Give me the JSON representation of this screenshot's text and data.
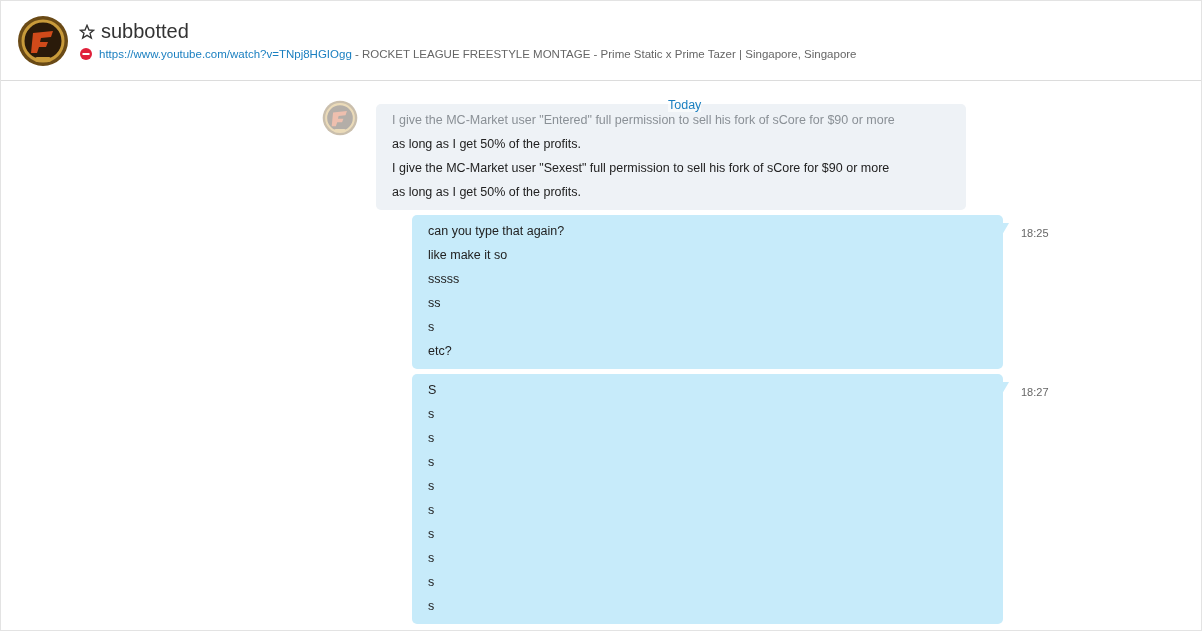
{
  "header": {
    "name": "subbotted",
    "favorite": false,
    "busy": true,
    "mood_link": "https://www.youtube.com/watch?v=TNpj8HGIOgg",
    "mood_text": " - ROCKET LEAGUE FREESTYLE MONTAGE - Prime Static x Prime Tazer",
    "separator": "|",
    "location": "Singapore, Singapore"
  },
  "date_divider": "Today",
  "messages": [
    {
      "kind": "incoming",
      "lines": [
        {
          "text": "I give the MC-Market user \"Entered\" full permission to sell his fork of sCore for $90 or more",
          "faded": true
        },
        {
          "text": "as long as I get 50% of the profits.",
          "faded": false
        },
        {
          "text": "I give the MC-Market user \"Sexest\" full permission to sell his fork of sCore for $90 or more",
          "faded": false
        },
        {
          "text": "as long as I get 50% of the profits.",
          "faded": false
        }
      ]
    },
    {
      "kind": "outgoing",
      "time": "18:25",
      "lines": [
        {
          "text": "can you type that again?",
          "faded": false
        },
        {
          "text": "like make it so",
          "faded": false
        },
        {
          "text": "sssss",
          "faded": false
        },
        {
          "text": "ss",
          "faded": false
        },
        {
          "text": "s",
          "faded": false
        },
        {
          "text": "etc?",
          "faded": false
        }
      ]
    },
    {
      "kind": "outgoing",
      "time": "18:27",
      "lines": [
        {
          "text": "S",
          "faded": false
        },
        {
          "text": "s",
          "faded": false
        },
        {
          "text": "s",
          "faded": false
        },
        {
          "text": "s",
          "faded": false
        },
        {
          "text": "s",
          "faded": false
        },
        {
          "text": "s",
          "faded": false
        },
        {
          "text": "s",
          "faded": false
        },
        {
          "text": "s",
          "faded": false
        },
        {
          "text": "s",
          "faded": false
        },
        {
          "text": "s",
          "faded": false
        }
      ]
    }
  ]
}
